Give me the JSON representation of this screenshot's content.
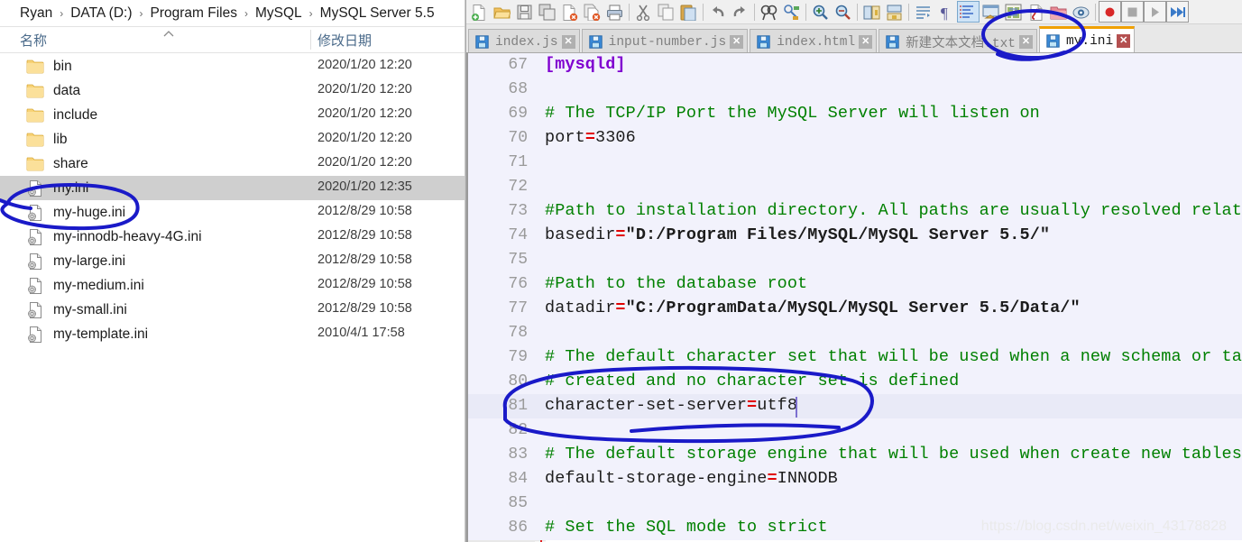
{
  "explorer": {
    "breadcrumb": {
      "items": [
        "Ryan",
        "DATA (D:)",
        "Program Files",
        "MySQL",
        "MySQL Server 5.5"
      ],
      "separator": "›"
    },
    "columns": {
      "name": "名称",
      "date_modified": "修改日期",
      "sort_caret": "ⱏ"
    },
    "rows": [
      {
        "name": "bin",
        "date": "2020/1/20 12:20",
        "type": "folder",
        "selected": false
      },
      {
        "name": "data",
        "date": "2020/1/20 12:20",
        "type": "folder",
        "selected": false
      },
      {
        "name": "include",
        "date": "2020/1/20 12:20",
        "type": "folder",
        "selected": false
      },
      {
        "name": "lib",
        "date": "2020/1/20 12:20",
        "type": "folder",
        "selected": false
      },
      {
        "name": "share",
        "date": "2020/1/20 12:20",
        "type": "folder",
        "selected": false
      },
      {
        "name": "my.ini",
        "date": "2020/1/20 12:35",
        "type": "ini",
        "selected": true
      },
      {
        "name": "my-huge.ini",
        "date": "2012/8/29 10:58",
        "type": "ini",
        "selected": false
      },
      {
        "name": "my-innodb-heavy-4G.ini",
        "date": "2012/8/29 10:58",
        "type": "ini",
        "selected": false
      },
      {
        "name": "my-large.ini",
        "date": "2012/8/29 10:58",
        "type": "ini",
        "selected": false
      },
      {
        "name": "my-medium.ini",
        "date": "2012/8/29 10:58",
        "type": "ini",
        "selected": false
      },
      {
        "name": "my-small.ini",
        "date": "2012/8/29 10:58",
        "type": "ini",
        "selected": false
      },
      {
        "name": "my-template.ini",
        "date": "2010/4/1 17:58",
        "type": "ini",
        "selected": false
      }
    ]
  },
  "editor_app": {
    "toolbar": [
      {
        "icon": "new-file-icon",
        "active": false,
        "sep_after": false
      },
      {
        "icon": "open-folder-icon",
        "active": false,
        "sep_after": false
      },
      {
        "icon": "save-icon",
        "active": false,
        "sep_after": false
      },
      {
        "icon": "save-all-icon",
        "active": false,
        "sep_after": false
      },
      {
        "icon": "close-file-icon",
        "active": false,
        "sep_after": false
      },
      {
        "icon": "close-all-files-icon",
        "active": false,
        "sep_after": false
      },
      {
        "icon": "print-icon",
        "active": false,
        "sep_after": true
      },
      {
        "icon": "cut-icon",
        "active": false,
        "sep_after": false
      },
      {
        "icon": "copy-icon",
        "active": false,
        "sep_after": false
      },
      {
        "icon": "paste-icon",
        "active": false,
        "sep_after": true
      },
      {
        "icon": "undo-icon",
        "active": false,
        "sep_after": false
      },
      {
        "icon": "redo-icon",
        "active": false,
        "sep_after": true
      },
      {
        "icon": "find-icon",
        "active": false,
        "sep_after": false
      },
      {
        "icon": "replace-icon",
        "active": false,
        "sep_after": true
      },
      {
        "icon": "zoom-in-icon",
        "active": false,
        "sep_after": false
      },
      {
        "icon": "zoom-out-icon",
        "active": false,
        "sep_after": true
      },
      {
        "icon": "sync-scroll-vertical-icon",
        "active": false,
        "sep_after": false
      },
      {
        "icon": "sync-scroll-horizontal-icon",
        "active": false,
        "sep_after": true
      },
      {
        "icon": "word-wrap-icon",
        "active": false,
        "sep_after": false
      },
      {
        "icon": "show-all-characters-icon",
        "active": false,
        "sep_after": false
      },
      {
        "icon": "indent-guide-icon",
        "active": true,
        "sep_after": false
      },
      {
        "icon": "user-defined-dialog-icon",
        "active": false,
        "sep_after": false
      },
      {
        "icon": "document-map-icon",
        "active": false,
        "sep_after": false
      },
      {
        "icon": "function-list-icon",
        "active": false,
        "sep_after": false
      },
      {
        "icon": "folder-as-workspace-icon",
        "active": false,
        "sep_after": false
      },
      {
        "icon": "monitoring-icon",
        "active": false,
        "sep_after": true
      },
      {
        "icon": "record-macro-icon",
        "active": false,
        "sep_after": false,
        "framed": true
      },
      {
        "icon": "stop-macro-icon",
        "active": false,
        "sep_after": false,
        "framed": true
      },
      {
        "icon": "play-macro-icon",
        "active": false,
        "sep_after": false,
        "framed": true
      },
      {
        "icon": "fast-play-macro-icon",
        "active": false,
        "sep_after": false,
        "framed": true
      }
    ],
    "tabs": [
      {
        "label": "index.js",
        "active": false,
        "modified": false
      },
      {
        "label": "input-number.js",
        "active": false,
        "modified": false
      },
      {
        "label": "index.html",
        "active": false,
        "modified": false
      },
      {
        "label": "新建文本文档.txt",
        "active": false,
        "modified": false
      },
      {
        "label": "my.ini",
        "active": true,
        "modified": false
      }
    ],
    "tab_close_glyph": "✕",
    "lines": [
      {
        "num": "67",
        "kind": "section",
        "text": "[mysqld]",
        "highlight": "section",
        "fold_head": true
      },
      {
        "num": "68",
        "kind": "blank",
        "text": "",
        "highlight": "section"
      },
      {
        "num": "69",
        "kind": "comment",
        "text": "# The TCP/IP Port the MySQL Server will listen on",
        "highlight": "section"
      },
      {
        "num": "70",
        "kind": "pair",
        "key": "port",
        "eq": "=",
        "value": "3306",
        "highlight": "section"
      },
      {
        "num": "71",
        "kind": "blank",
        "text": "",
        "highlight": "section"
      },
      {
        "num": "72",
        "kind": "blank",
        "text": "",
        "highlight": "section"
      },
      {
        "num": "73",
        "kind": "comment",
        "text": "#Path to installation directory. All paths are usually resolved relative to this.",
        "highlight": "section"
      },
      {
        "num": "74",
        "kind": "pair",
        "key": "basedir",
        "eq": "=",
        "value": "\"D:/Program Files/MySQL/MySQL Server 5.5/\"",
        "highlight": "section"
      },
      {
        "num": "75",
        "kind": "blank",
        "text": "",
        "highlight": "section"
      },
      {
        "num": "76",
        "kind": "comment",
        "text": "#Path to the database root",
        "highlight": "section"
      },
      {
        "num": "77",
        "kind": "pair",
        "key": "datadir",
        "eq": "=",
        "value": "\"C:/ProgramData/MySQL/MySQL Server 5.5/Data/\"",
        "highlight": "section"
      },
      {
        "num": "78",
        "kind": "blank",
        "text": "",
        "highlight": "section"
      },
      {
        "num": "79",
        "kind": "comment",
        "text": "# The default character set that will be used when a new schema or table is",
        "highlight": "section"
      },
      {
        "num": "80",
        "kind": "comment",
        "text": "# created and no character set is defined",
        "highlight": "section"
      },
      {
        "num": "81",
        "kind": "pair",
        "key": "character-set-server",
        "eq": "=",
        "value": "utf8",
        "highlight": "line",
        "caret_after": true
      },
      {
        "num": "82",
        "kind": "blank",
        "text": "",
        "highlight": "section"
      },
      {
        "num": "83",
        "kind": "comment",
        "text": "# The default storage engine that will be used when create new tables when",
        "highlight": "section"
      },
      {
        "num": "84",
        "kind": "pair",
        "key": "default-storage-engine",
        "eq": "=",
        "value": "INNODB",
        "highlight": "section"
      },
      {
        "num": "85",
        "kind": "blank",
        "text": "",
        "highlight": "section"
      },
      {
        "num": "86",
        "kind": "comment",
        "text": "# Set the SQL mode to strict",
        "highlight": "section"
      }
    ]
  },
  "watermark": "https://blog.csdn.net/weixin_43178828",
  "annotations": {
    "ink_color": "#1a1ac8",
    "marks": [
      {
        "name": "circle-around-my-ini-file",
        "shape": "ellipse"
      },
      {
        "name": "circle-around-my-ini-tab",
        "shape": "ellipse"
      },
      {
        "name": "circle-around-character-set-server-line",
        "shape": "ellipse"
      }
    ]
  },
  "colors": {
    "selection_gray": "#cfcfcf",
    "tab_active_accent": "#f0a000",
    "comment_green": "#008000",
    "section_purple": "#8000d0",
    "operator_red": "#e00000",
    "fold_line_red": "#e02020",
    "current_line_blue": "#e9eaf7",
    "ink_blue": "#1a1ac8"
  }
}
